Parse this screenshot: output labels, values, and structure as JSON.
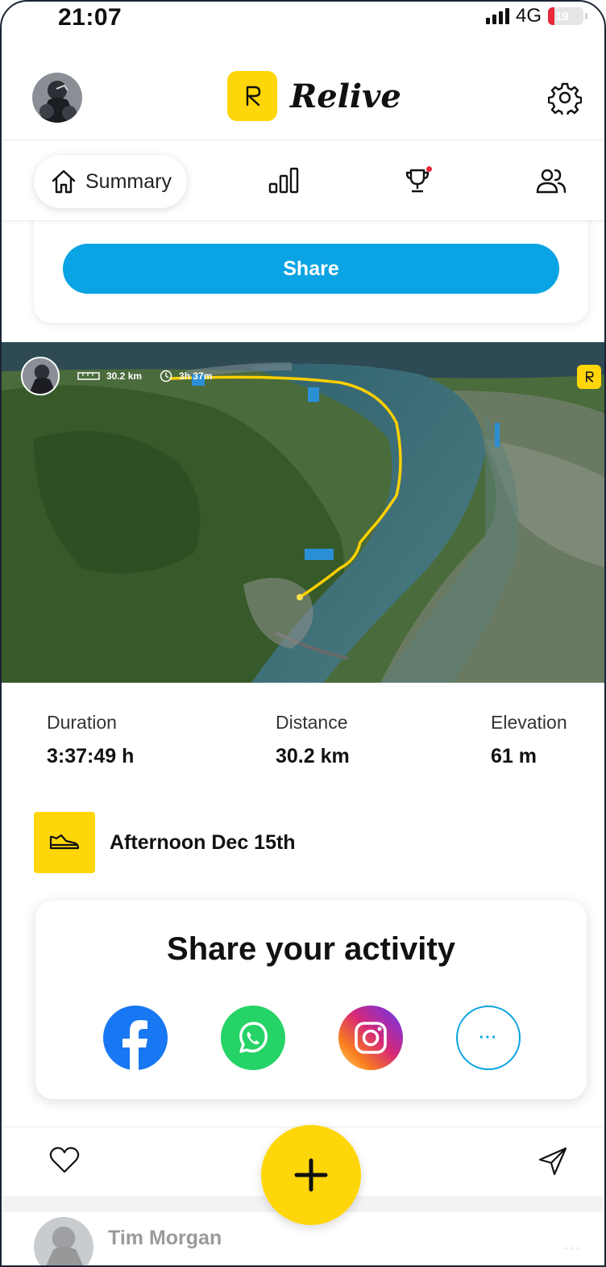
{
  "status_bar": {
    "time": "21:07",
    "network": "4G",
    "battery": "19"
  },
  "header": {
    "app_name": "Relive"
  },
  "tabs": {
    "summary_label": "Summary"
  },
  "share_card": {
    "button_label": "Share"
  },
  "map": {
    "distance": "30.2 km",
    "duration": "3h 37m"
  },
  "stats": {
    "duration_label": "Duration",
    "duration_value": "3:37:49 h",
    "distance_label": "Distance",
    "distance_value": "30.2 km",
    "elevation_label": "Elevation",
    "elevation_value": "61 m"
  },
  "activity": {
    "title": "Afternoon Dec 15th"
  },
  "share_activity": {
    "title": "Share your activity",
    "more_label": "···"
  },
  "next_post": {
    "user_name": "Tim Morgan",
    "more_label": "···"
  },
  "colors": {
    "accent_yellow": "#ffd60a",
    "share_blue": "#0aa3e3",
    "facebook": "#1877f2",
    "whatsapp": "#25d366",
    "route": "#ffd000"
  },
  "icons": {
    "settings": "gear-icon",
    "summary": "home-icon",
    "stats": "bar-chart-icon",
    "trophy": "trophy-icon",
    "friends": "people-icon",
    "activity": "shoe-icon",
    "like": "heart-icon",
    "send": "paper-plane-icon",
    "fab": "plus-icon"
  }
}
